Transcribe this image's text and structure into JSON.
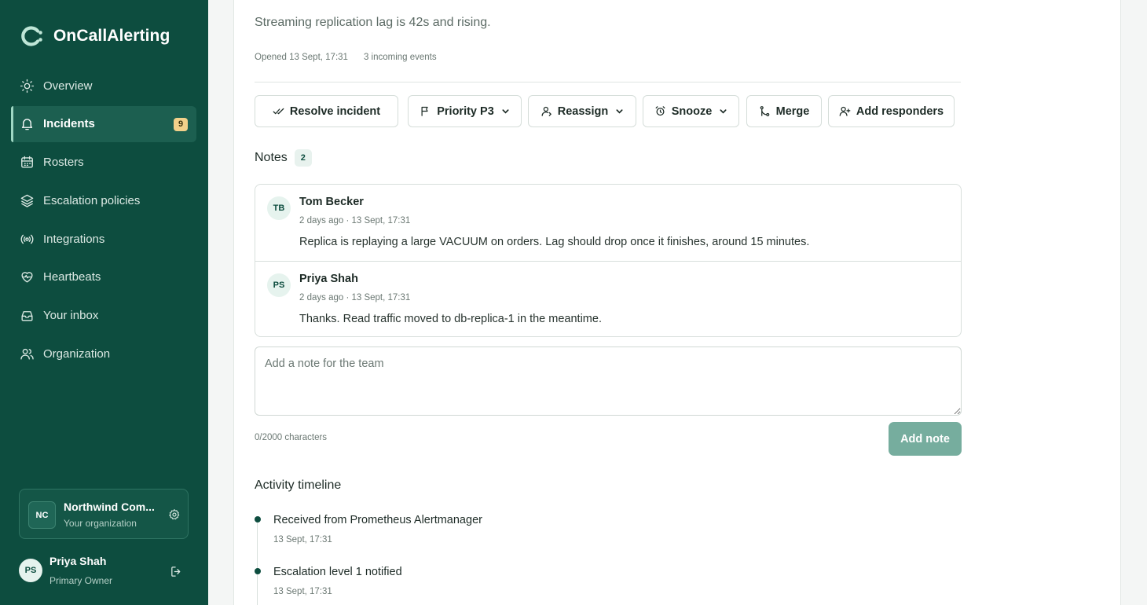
{
  "app": {
    "name": "OnCallAlerting"
  },
  "sidebar": {
    "items": [
      {
        "label": "Overview",
        "icon": "sun-icon"
      },
      {
        "label": "Incidents",
        "icon": "bell-icon",
        "badge": "9",
        "active": true
      },
      {
        "label": "Rosters",
        "icon": "calendar-icon"
      },
      {
        "label": "Escalation policies",
        "icon": "layers-icon"
      },
      {
        "label": "Integrations",
        "icon": "broadcast-icon"
      },
      {
        "label": "Heartbeats",
        "icon": "heart-pulse-icon"
      },
      {
        "label": "Your inbox",
        "icon": "inbox-icon"
      },
      {
        "label": "Organization",
        "icon": "users-icon"
      }
    ],
    "org": {
      "initials": "NC",
      "name": "Northwind Com...",
      "subtitle": "Your organization"
    },
    "user": {
      "initials": "PS",
      "name": "Priya Shah",
      "role": "Primary Owner"
    }
  },
  "incident": {
    "description": "Streaming replication lag is 42s and rising.",
    "opened": "Opened 13 Sept, 17:31",
    "events": "3 incoming events"
  },
  "actions": {
    "resolve": "Resolve incident",
    "priority": "Priority P3",
    "reassign": "Reassign",
    "snooze": "Snooze",
    "merge": "Merge",
    "add_responders": "Add responders"
  },
  "notes": {
    "title": "Notes",
    "count": "2",
    "items": [
      {
        "initials": "TB",
        "author": "Tom Becker",
        "time": "2 days ago · 13 Sept, 17:31",
        "body": "Replica is replaying a large VACUUM on orders. Lag should drop once it finishes, around 15 minutes."
      },
      {
        "initials": "PS",
        "author": "Priya Shah",
        "time": "2 days ago · 13 Sept, 17:31",
        "body": "Thanks. Read traffic moved to db-replica-1 in the meantime."
      }
    ],
    "input_placeholder": "Add a note for the team",
    "char_count": "0/2000 characters",
    "submit": "Add note"
  },
  "timeline": {
    "title": "Activity timeline",
    "items": [
      {
        "text": "Received from Prometheus Alertmanager",
        "time": "13 Sept, 17:31"
      },
      {
        "text": "Escalation level 1 notified",
        "time": "13 Sept, 17:31"
      }
    ]
  },
  "colors": {
    "sidebar": "#0d4d3f",
    "accent": "#76ad9e",
    "badge": "#f2d08a"
  }
}
